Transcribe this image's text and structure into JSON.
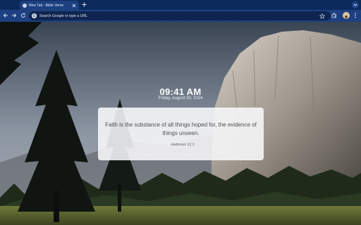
{
  "browser": {
    "tab": {
      "title": "New Tab - Bible Verse"
    },
    "omnibox": {
      "placeholder": "Search Google or type a URL"
    }
  },
  "page": {
    "clock": "09:41 AM",
    "date": "Friday, August 30, 2024",
    "verse": {
      "text": "Faith is the substance of all things hoped for, the evidence of things unseen.",
      "reference": "Hebrews 11:1"
    }
  },
  "icons": {
    "tab_favicon": "bible-icon",
    "tab_close": "close-icon",
    "new_tab": "plus-icon",
    "tab_search": "chevron-down-icon",
    "back": "arrow-left-icon",
    "forward": "arrow-right-icon",
    "reload": "reload-icon",
    "omnibox": "google-icon",
    "bookmark": "star-icon",
    "extensions": "puzzle-icon",
    "profile": "avatar",
    "menu": "kebab-menu-icon"
  },
  "colors": {
    "tabstrip": "#0c2a5c",
    "toolbar": "#1d4080",
    "omnibox": "#0f2550",
    "card": "#f8f8fa",
    "clock_text": "#ffffff"
  }
}
